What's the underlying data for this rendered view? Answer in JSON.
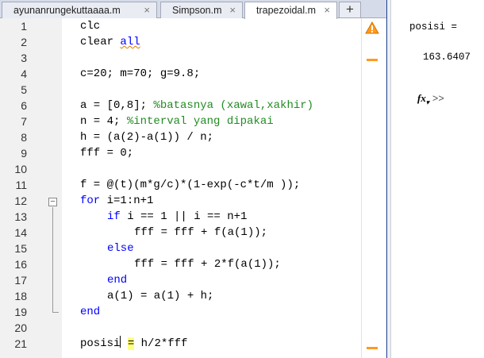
{
  "tabs": [
    {
      "label": "ayunanrungekuttaaaa.m",
      "close": "×"
    },
    {
      "label": "Simpson.m",
      "close": "×"
    },
    {
      "label": "trapezoidal.m",
      "close": "×"
    }
  ],
  "add_tab_label": "+",
  "line_numbers": [
    "1",
    "2",
    "3",
    "4",
    "5",
    "6",
    "7",
    "8",
    "9",
    "10",
    "11",
    "12",
    "13",
    "14",
    "15",
    "16",
    "17",
    "18",
    "19",
    "20",
    "21"
  ],
  "fold_toggle": "−",
  "code": {
    "l1": "clc",
    "l2_kw": "clear ",
    "l2_arg": "all",
    "l4": "c=20; m=70; g=9.8;",
    "l6_code": "a = [0,8]; ",
    "l6_comment": "%batasnya (xawal,xakhir)",
    "l7_code": "n = 4; ",
    "l7_comment": "%interval yang dipakai",
    "l8": "h = (a(2)-a(1)) / n;",
    "l9": "fff = 0;",
    "l11": "f = @(t)(m*g/c)*(1-exp(-c*t/m ));",
    "l12_kw": "for",
    "l12_rest": " i=1:n+1",
    "l13_kw": "if",
    "l13_rest": " i == 1 || i == n+1",
    "l14": "fff = fff + f(a(1));",
    "l15_kw": "else",
    "l16": "fff = fff + 2*f(a(1));",
    "l17_kw": "end",
    "l18": "a(1) = a(1) + h;",
    "l19_kw": "end",
    "l21_a": "posisi",
    "l21_eq": "=",
    "l21_b": " h/2*fff"
  },
  "command_window": {
    "output_label": "posisi =",
    "output_value": "163.6407",
    "fx_label": "fx",
    "prompt": ">>"
  },
  "colors": {
    "keyword": "#0000ff",
    "comment": "#228b22",
    "warning": "#ff9a1e"
  }
}
